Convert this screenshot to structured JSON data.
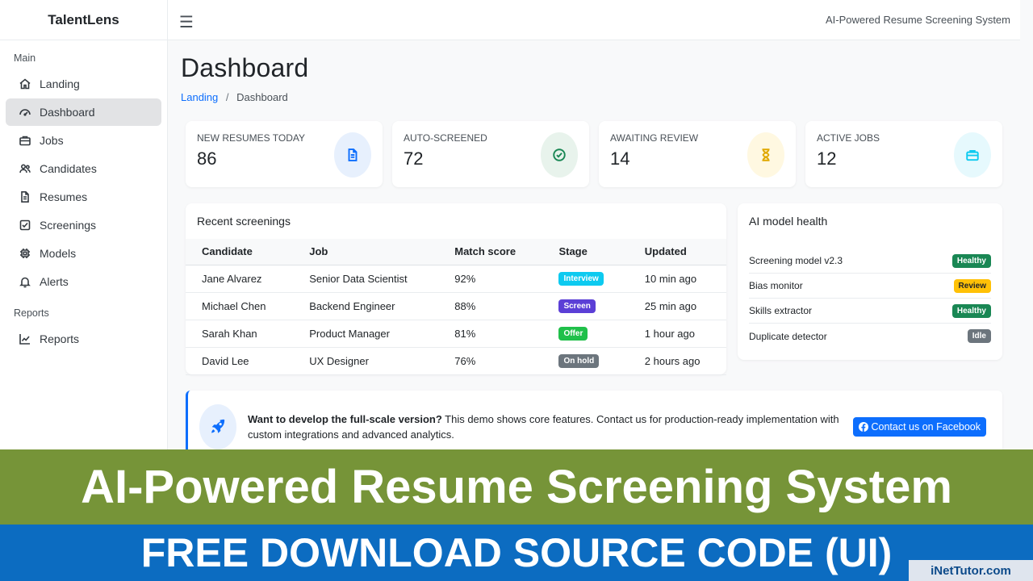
{
  "brand": "TalentLens",
  "topbar": {
    "title": "AI-Powered Resume Screening System"
  },
  "sidebar": {
    "sections": [
      {
        "label": "Main",
        "items": [
          {
            "label": "Landing",
            "icon": "home-icon"
          },
          {
            "label": "Dashboard",
            "icon": "gauge-icon",
            "active": true
          },
          {
            "label": "Jobs",
            "icon": "briefcase-icon"
          },
          {
            "label": "Candidates",
            "icon": "users-icon"
          },
          {
            "label": "Resumes",
            "icon": "file-icon"
          },
          {
            "label": "Screenings",
            "icon": "check-square-icon"
          },
          {
            "label": "Models",
            "icon": "cpu-icon"
          },
          {
            "label": "Alerts",
            "icon": "bell-icon"
          }
        ]
      },
      {
        "label": "Reports",
        "items": [
          {
            "label": "Reports",
            "icon": "chart-line-icon"
          }
        ]
      }
    ]
  },
  "page": {
    "title": "Dashboard",
    "breadcrumb": {
      "link": "Landing",
      "separator": "/",
      "current": "Dashboard"
    }
  },
  "stats": [
    {
      "label": "NEW RESUMES TODAY",
      "value": "86",
      "icon": "file-text-icon",
      "color": "#0d6efd",
      "bg": "#e7f0fd"
    },
    {
      "label": "AUTO-SCREENED",
      "value": "72",
      "icon": "check-circle-icon",
      "color": "#198754",
      "bg": "#e8f3ec"
    },
    {
      "label": "AWAITING REVIEW",
      "value": "14",
      "icon": "hourglass-icon",
      "color": "#e0a800",
      "bg": "#fff8e1"
    },
    {
      "label": "ACTIVE JOBS",
      "value": "12",
      "icon": "briefcase-icon",
      "color": "#0dcaf0",
      "bg": "#e6f9fd"
    }
  ],
  "screenings": {
    "title": "Recent screenings",
    "columns": [
      "Candidate",
      "Job",
      "Match score",
      "Stage",
      "Updated"
    ],
    "rows": [
      {
        "candidate": "Jane Alvarez",
        "job": "Senior Data Scientist",
        "score": "92%",
        "stage": "Interview",
        "stage_color": "#0dcaf0",
        "updated": "10 min ago"
      },
      {
        "candidate": "Michael Chen",
        "job": "Backend Engineer",
        "score": "88%",
        "stage": "Screen",
        "stage_color": "#5b3fd6",
        "updated": "25 min ago"
      },
      {
        "candidate": "Sarah Khan",
        "job": "Product Manager",
        "score": "81%",
        "stage": "Offer",
        "stage_color": "#20c04a",
        "updated": "1 hour ago"
      },
      {
        "candidate": "David Lee",
        "job": "UX Designer",
        "score": "76%",
        "stage": "On hold",
        "stage_color": "#6c757d",
        "updated": "2 hours ago"
      }
    ]
  },
  "health": {
    "title": "AI model health",
    "items": [
      {
        "name": "Screening model v2.3",
        "status": "Healthy",
        "color": "#198754",
        "text": "#ffffff"
      },
      {
        "name": "Bias monitor",
        "status": "Review",
        "color": "#ffc107",
        "text": "#212529"
      },
      {
        "name": "Skills extractor",
        "status": "Healthy",
        "color": "#198754",
        "text": "#ffffff"
      },
      {
        "name": "Duplicate detector",
        "status": "Idle",
        "color": "#6c757d",
        "text": "#ffffff"
      }
    ]
  },
  "promo": {
    "bold": "Want to develop the full-scale version?",
    "text": " This demo shows core features. Contact us for production-ready implementation with custom integrations and advanced analytics.",
    "button": "Contact us on Facebook",
    "icon": "rocket-icon"
  },
  "banner": {
    "line1": "AI-Powered Resume Screening System",
    "line2": "FREE DOWNLOAD SOURCE CODE (UI)",
    "watermark": "iNetTutor.com"
  }
}
